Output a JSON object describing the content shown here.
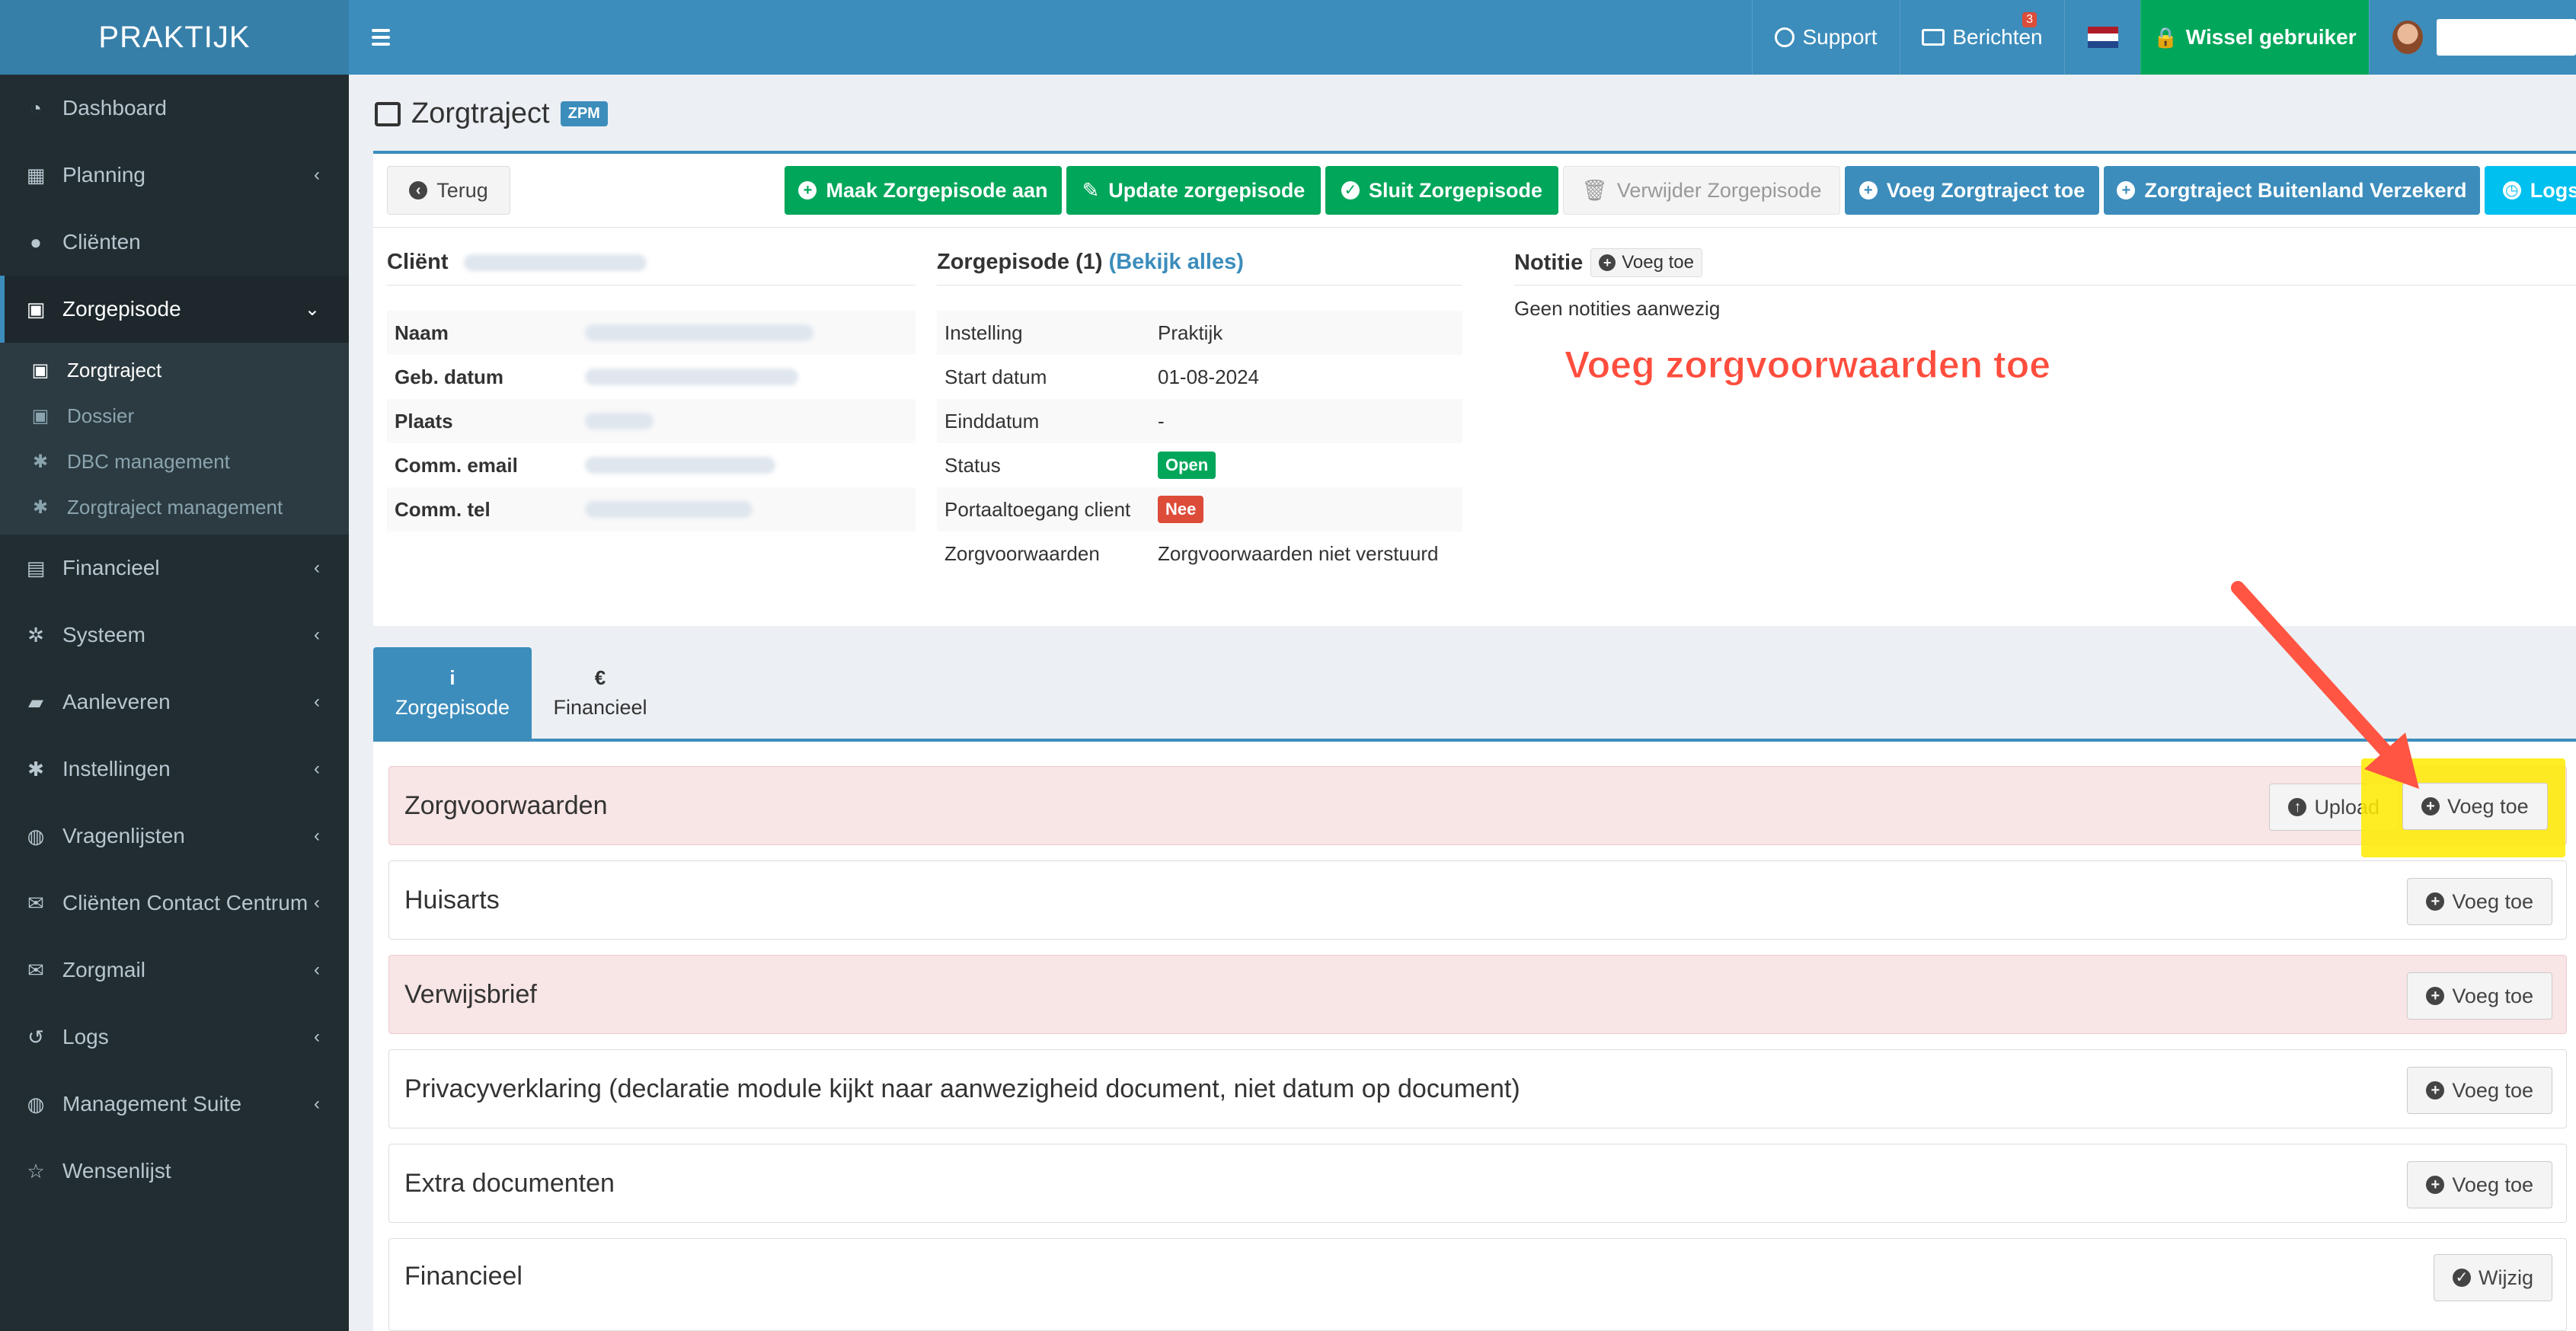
{
  "app": {
    "logo": "PRAKTIJK"
  },
  "topbar": {
    "support": "Support",
    "berichten": "Berichten",
    "berichten_count": "3",
    "wissel": "Wissel gebruiker",
    "user_name": "",
    "flag_colors": [
      "#ae1c28",
      "#ffffff",
      "#21468b"
    ]
  },
  "sidebar": {
    "items": [
      {
        "label": "Dashboard",
        "icon": "dashboard-icon"
      },
      {
        "label": "Planning",
        "icon": "calendar-icon"
      },
      {
        "label": "Cliënten",
        "icon": "user-icon"
      },
      {
        "label": "Zorgepisode",
        "icon": "medkit-icon"
      },
      {
        "label": "Financieel",
        "icon": "book-icon"
      },
      {
        "label": "Systeem",
        "icon": "cogs-icon"
      },
      {
        "label": "Aanleveren",
        "icon": "truck-icon"
      },
      {
        "label": "Instellingen",
        "icon": "gear-icon"
      },
      {
        "label": "Vragenlijsten",
        "icon": "globe-icon"
      },
      {
        "label": "Cliënten Contact Centrum",
        "icon": "envelope-icon"
      },
      {
        "label": "Zorgmail",
        "icon": "envelope-icon"
      },
      {
        "label": "Logs",
        "icon": "history-icon"
      },
      {
        "label": "Management Suite",
        "icon": "globe-icon"
      },
      {
        "label": "Wensenlijst",
        "icon": "star-icon"
      }
    ],
    "sub_items": [
      {
        "label": "Zorgtraject",
        "icon": "medkit-icon"
      },
      {
        "label": "Dossier",
        "icon": "medkit-icon"
      },
      {
        "label": "DBC management",
        "icon": "gear-icon"
      },
      {
        "label": "Zorgtraject management",
        "icon": "gear-icon"
      }
    ]
  },
  "page": {
    "title": "Zorgtraject",
    "badge": "ZPM"
  },
  "toolbar": {
    "back": "Terug",
    "maak": "Maak Zorgepisode aan",
    "update": "Update zorgepisode",
    "sluit": "Sluit Zorgepisode",
    "verwijder": "Verwijder Zorgepisode",
    "voeg_traject": "Voeg Zorgtraject toe",
    "buitenland": "Zorgtraject Buitenland Verzekerd",
    "logs": "Logs"
  },
  "client": {
    "heading": "Cliënt",
    "rows": [
      {
        "key": "Naam"
      },
      {
        "key": "Geb. datum"
      },
      {
        "key": "Plaats"
      },
      {
        "key": "Comm. email"
      },
      {
        "key": "Comm. tel"
      }
    ]
  },
  "episode": {
    "heading": "Zorgepisode (1)",
    "heading_link": "(Bekijk alles)",
    "rows": [
      {
        "key": "Instelling",
        "value": "Praktijk"
      },
      {
        "key": "Start datum",
        "value": "01-08-2024"
      },
      {
        "key": "Einddatum",
        "value": "-"
      },
      {
        "key": "Status",
        "value": "Open"
      },
      {
        "key": "Portaaltoegang client",
        "value": "Nee"
      },
      {
        "key": "Zorgvoorwaarden",
        "value": "Zorgvoorwaarden niet verstuurd"
      }
    ]
  },
  "notitie": {
    "heading": "Notitie",
    "add": "Voeg toe",
    "empty": "Geen notities aanwezig"
  },
  "annotation": "Voeg zorgvoorwaarden toe",
  "tabs": [
    {
      "label": "Zorgepisode",
      "icon": "info-icon",
      "glyph": "i"
    },
    {
      "label": "Financieel",
      "icon": "euro-icon",
      "glyph": "€"
    }
  ],
  "documents": [
    {
      "title": "Zorgvoorwaarden",
      "upload": "Upload",
      "add": "Voeg toe"
    },
    {
      "title": "Huisarts",
      "add": "Voeg toe"
    },
    {
      "title": "Verwijsbrief",
      "add": "Voeg toe"
    },
    {
      "title": "Privacyverklaring (declaratie module kijkt naar aanwezigheid document, niet datum op document)",
      "add": "Voeg toe"
    },
    {
      "title": "Extra documenten",
      "add": "Voeg toe"
    },
    {
      "title": "Financieel",
      "edit": "Wijzig"
    }
  ],
  "colors": {
    "primary": "#3c8dbc",
    "success": "#00a65a",
    "danger": "#dd4b39",
    "info": "#00c0ef",
    "sidebar": "#222d32",
    "highlight": "#ffeb00",
    "annotation": "#ff4d3d"
  }
}
